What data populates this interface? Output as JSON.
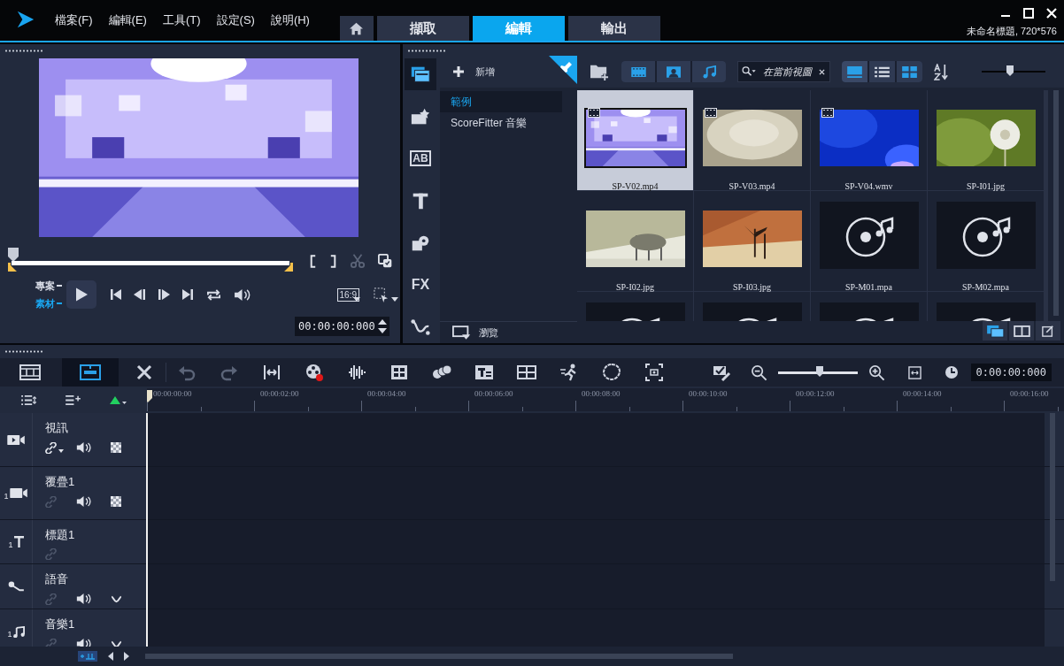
{
  "app": {
    "menu": [
      "檔案(F)",
      "編輯(E)",
      "工具(T)",
      "設定(S)",
      "說明(H)"
    ],
    "title": "未命名標題, 720*576"
  },
  "tabs": [
    {
      "kind": "home",
      "selected": false
    },
    {
      "kind": "text",
      "label": "擷取",
      "selected": false
    },
    {
      "kind": "text",
      "label": "編輯",
      "selected": true
    },
    {
      "kind": "text",
      "label": "輸出",
      "selected": false
    }
  ],
  "player": {
    "scrubber": {
      "level": 0
    },
    "modes": [
      {
        "label": "專案",
        "selected": false
      },
      {
        "label": "素材",
        "selected": true
      }
    ],
    "aspect": "16:9",
    "timecode": "00:00:00:000"
  },
  "library": {
    "categories": [
      {
        "kind": "media",
        "selected": true
      },
      {
        "kind": "instant",
        "selected": false
      },
      {
        "kind": "transition",
        "label": "AB",
        "selected": false
      },
      {
        "kind": "title",
        "selected": false
      },
      {
        "kind": "graphics",
        "selected": false
      },
      {
        "kind": "fx",
        "label": "FX",
        "selected": false
      },
      {
        "kind": "path",
        "selected": false
      }
    ],
    "add_label": "新增",
    "folders": [
      {
        "label": "範例",
        "selected": true
      },
      {
        "label": "ScoreFitter 音樂",
        "selected": false
      }
    ],
    "browse_label": "瀏覽",
    "search": {
      "placeholder": "在當前視圖"
    },
    "zoom": {
      "level": 0.45
    },
    "items": [
      {
        "name": "SP-V02.mp4",
        "kind": "video",
        "selected": true
      },
      {
        "name": "SP-V03.mp4",
        "kind": "video",
        "selected": false
      },
      {
        "name": "SP-V04.wmv",
        "kind": "video",
        "selected": false
      },
      {
        "name": "SP-I01.jpg",
        "selected": false
      },
      {
        "name": "SP-I02.jpg",
        "selected": false
      },
      {
        "name": "SP-I03.jpg",
        "selected": false
      },
      {
        "name": "SP-M01.mpa",
        "kind": "audio",
        "selected": false
      },
      {
        "name": "SP-M02.mpa",
        "kind": "audio",
        "selected": false
      },
      {
        "kind": "audio",
        "selected": false
      },
      {
        "kind": "audio",
        "selected": false
      },
      {
        "kind": "audio",
        "selected": false
      },
      {
        "kind": "audio",
        "selected": false
      }
    ],
    "layouts": [
      {
        "selected": true
      },
      {
        "selected": false
      },
      {
        "selected": false
      }
    ]
  },
  "timeline": {
    "views": [
      {
        "kind": "storyboard",
        "selected": false
      },
      {
        "kind": "timeline",
        "selected": true
      }
    ],
    "zoom": {
      "level": 0.53
    },
    "timecode": "0:00:00:000",
    "ruler": [
      "00:00:00:00",
      "00:00:02:00",
      "00:00:04:00",
      "00:00:06:00",
      "00:00:08:00",
      "00:00:10:00",
      "00:00:12:00",
      "00:00:14:00",
      "00:00:16:00"
    ],
    "tracks": [
      {
        "name": "視訊",
        "kind": "video"
      },
      {
        "name": "覆疊1",
        "kind": "overlay",
        "index": "1"
      },
      {
        "name": "標題1",
        "kind": "title",
        "index": "1"
      },
      {
        "name": "語音",
        "kind": "voice"
      },
      {
        "name": "音樂1",
        "kind": "music",
        "index": "1"
      }
    ]
  }
}
